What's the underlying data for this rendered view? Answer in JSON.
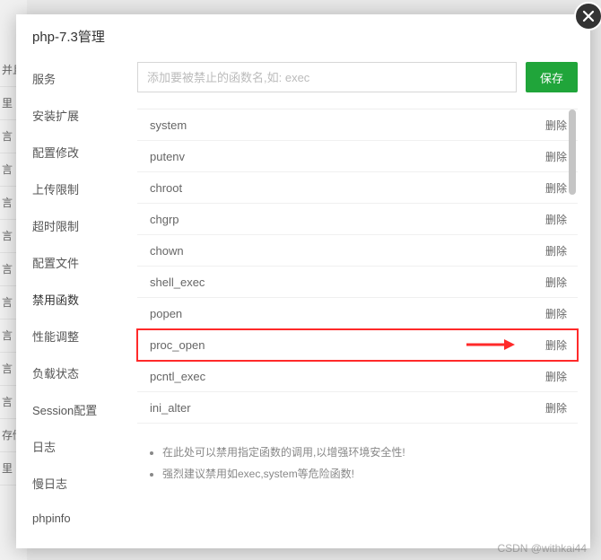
{
  "modal": {
    "title": "php-7.3管理",
    "close_label": "close"
  },
  "sidebar": {
    "items": [
      {
        "label": "服务"
      },
      {
        "label": "安装扩展"
      },
      {
        "label": "配置修改"
      },
      {
        "label": "上传限制"
      },
      {
        "label": "超时限制"
      },
      {
        "label": "配置文件"
      },
      {
        "label": "禁用函数",
        "active": true
      },
      {
        "label": "性能调整"
      },
      {
        "label": "负载状态"
      },
      {
        "label": "Session配置"
      },
      {
        "label": "日志"
      },
      {
        "label": "慢日志"
      },
      {
        "label": "phpinfo"
      }
    ]
  },
  "input": {
    "placeholder": "添加要被禁止的函数名,如: exec",
    "save_label": "保存"
  },
  "functions": {
    "delete_label": "删除",
    "items": [
      {
        "name": "system"
      },
      {
        "name": "putenv"
      },
      {
        "name": "chroot"
      },
      {
        "name": "chgrp"
      },
      {
        "name": "chown"
      },
      {
        "name": "shell_exec"
      },
      {
        "name": "popen"
      },
      {
        "name": "proc_open",
        "highlight": true
      },
      {
        "name": "pcntl_exec"
      },
      {
        "name": "ini_alter"
      }
    ]
  },
  "tips": {
    "items": [
      "在此处可以禁用指定函数的调用,以增强环境安全性!",
      "强烈建议禁用如exec,system等危险函数!"
    ]
  },
  "bg_rows": [
    "并且",
    "里",
    "言",
    "言",
    "言",
    "言",
    "言",
    "言",
    "言",
    "言",
    "言",
    "存储",
    "里"
  ],
  "watermark": "CSDN @withkai44"
}
